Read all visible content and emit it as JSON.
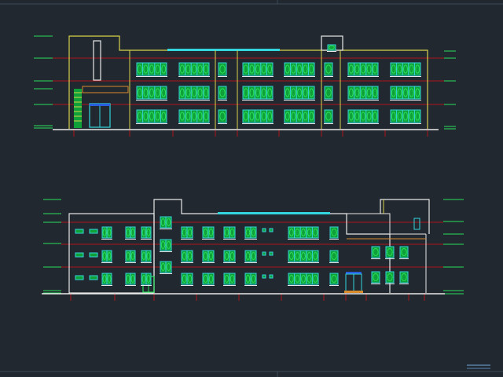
{
  "app": {
    "background": "#212830",
    "frame_color": "#3d4a58"
  },
  "palette": {
    "outline": "#e8e8e8",
    "yellow": "#d9d34a",
    "red": "#b0141a",
    "red_dim": "#7a1116",
    "cyan": "#33d6dc",
    "green": "#29e05a",
    "green_dark": "#0fa03a",
    "blue": "#2a5ee0",
    "orange": "#d98a2a"
  },
  "drawings": [
    {
      "id": "south-elevation",
      "label": "",
      "floors": 3
    },
    {
      "id": "north-elevation",
      "label": "",
      "floors": 3
    }
  ],
  "icons": {
    "title_block": "title-block-icon"
  }
}
